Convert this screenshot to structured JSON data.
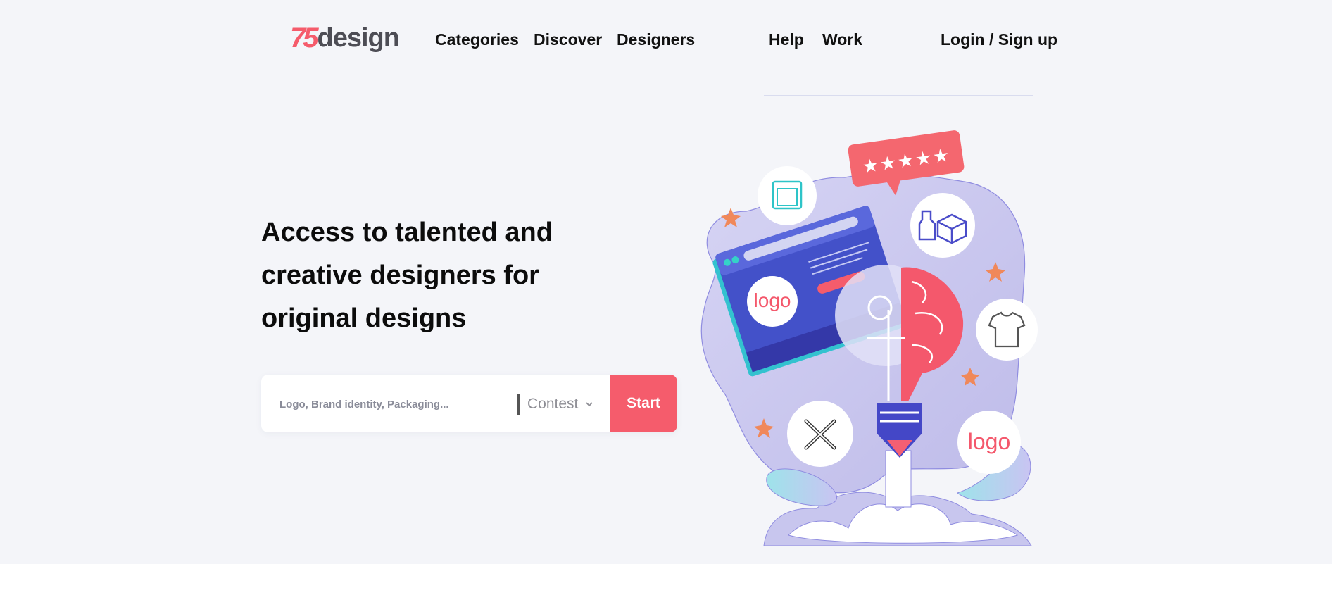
{
  "brand": {
    "mark": "75",
    "word": "design"
  },
  "nav": {
    "categories": "Categories",
    "discover": "Discover",
    "designers": "Designers",
    "help": "Help",
    "work": "Work",
    "login": "Login / Sign up"
  },
  "hero": {
    "headline": "Access to talented and creative designers for original designs"
  },
  "search": {
    "placeholder": "Logo, Brand identity, Packaging...",
    "type_selected": "Contest",
    "start_label": "Start"
  },
  "illustration": {
    "badge_text": "logo"
  },
  "colors": {
    "accent": "#f55c6c",
    "background": "#f4f5f9",
    "lavender": "#c8c6ee",
    "indigo": "#4a4cc9"
  }
}
